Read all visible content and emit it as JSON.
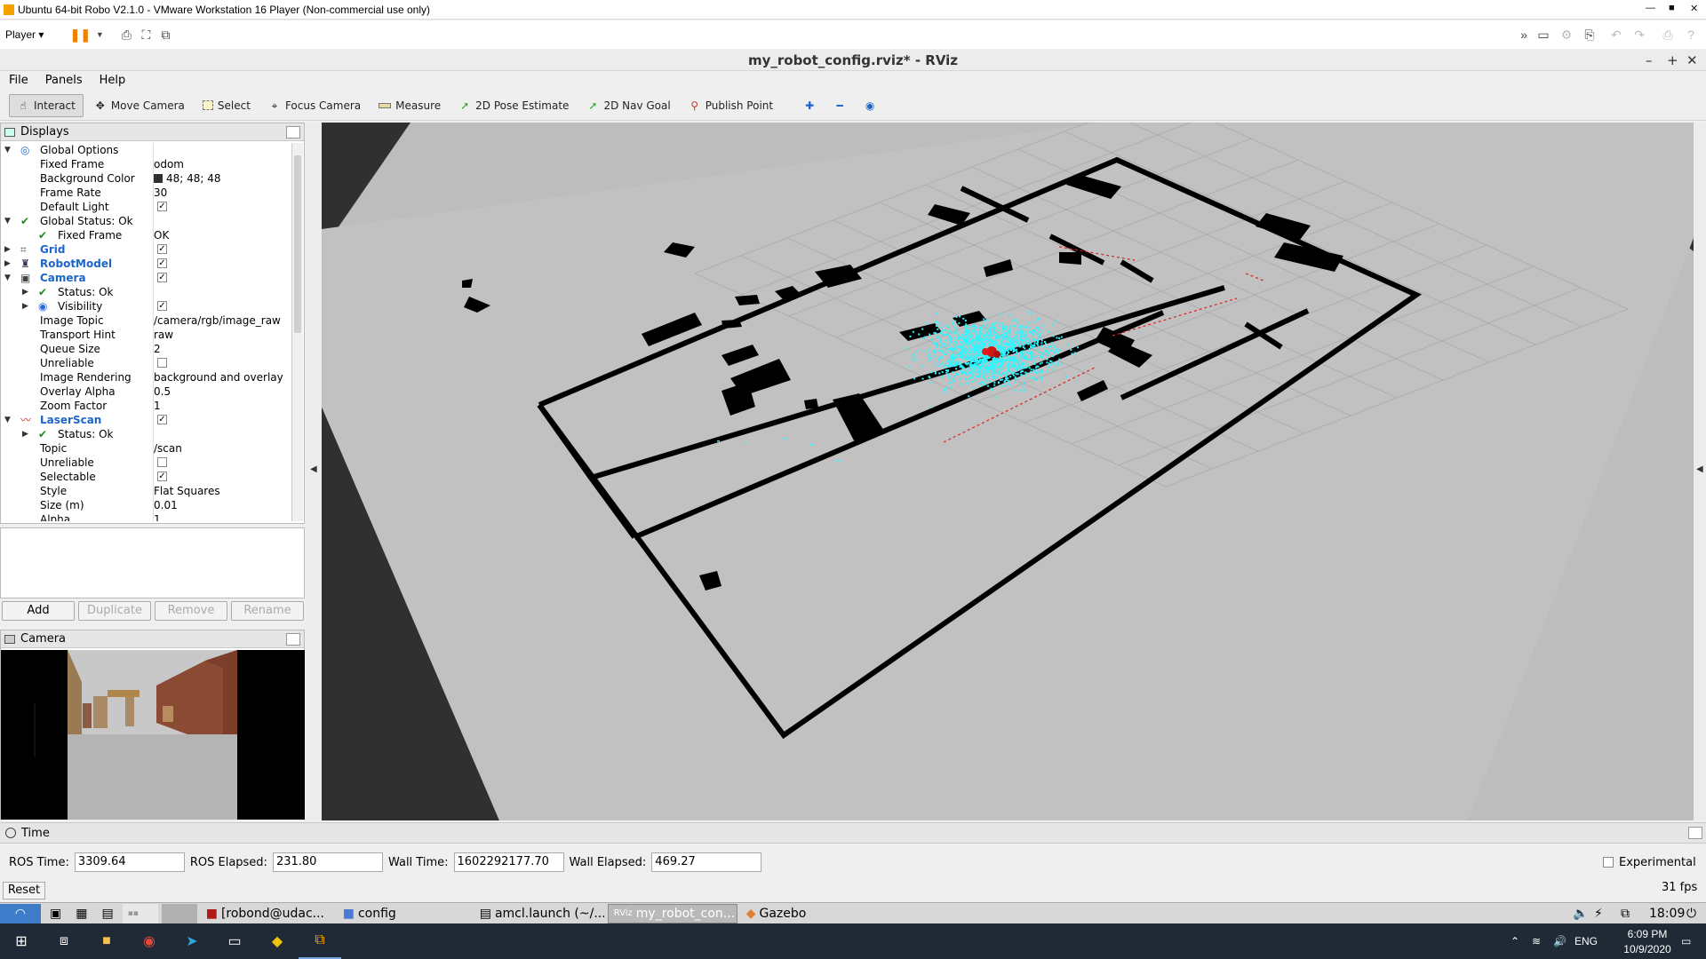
{
  "vm": {
    "title": "Ubuntu 64-bit Robo V2.1.0 - VMware Workstation 16 Player (Non-commercial use only)",
    "player_label": "Player"
  },
  "rviz": {
    "title": "my_robot_config.rviz* - RViz",
    "menu": [
      "File",
      "Panels",
      "Help"
    ],
    "tools": [
      {
        "label": "Interact",
        "icon": "cursor-icon",
        "active": true
      },
      {
        "label": "Move Camera",
        "icon": "move-icon"
      },
      {
        "label": "Select",
        "icon": "select-icon"
      },
      {
        "label": "Focus Camera",
        "icon": "focus-icon"
      },
      {
        "label": "Measure",
        "icon": "ruler-icon"
      },
      {
        "label": "2D Pose Estimate",
        "icon": "green-arrow-icon"
      },
      {
        "label": "2D Nav Goal",
        "icon": "green-arrow-icon"
      },
      {
        "label": "Publish Point",
        "icon": "pin-icon"
      }
    ]
  },
  "displays": {
    "title": "Displays",
    "rows": [
      {
        "level": 0,
        "arrow": "down",
        "icon": "globe",
        "key": "Global Options",
        "val": ""
      },
      {
        "level": 1,
        "key": "Fixed Frame",
        "val": "odom"
      },
      {
        "level": 1,
        "key": "Background Color",
        "val": "48; 48; 48",
        "swatch": true
      },
      {
        "level": 1,
        "key": "Frame Rate",
        "val": "30"
      },
      {
        "level": 1,
        "key": "Default Light",
        "check": true
      },
      {
        "level": 0,
        "arrow": "down",
        "icon": "check",
        "key": "Global Status: Ok",
        "val": ""
      },
      {
        "level": 1,
        "icon": "check",
        "key": "Fixed Frame",
        "val": "OK"
      },
      {
        "level": 0,
        "arrow": "right",
        "icon": "grid",
        "key": "Grid",
        "blue": true,
        "check": true
      },
      {
        "level": 0,
        "arrow": "right",
        "icon": "robot",
        "key": "RobotModel",
        "blue": true,
        "check": true
      },
      {
        "level": 0,
        "arrow": "down",
        "icon": "camera",
        "key": "Camera",
        "blue": true,
        "check": true
      },
      {
        "level": 1,
        "arrow": "right",
        "icon": "check",
        "key": "Status: Ok",
        "val": ""
      },
      {
        "level": 1,
        "arrow": "right",
        "icon": "eye",
        "key": "Visibility",
        "check": true
      },
      {
        "level": 1,
        "key": "Image Topic",
        "val": "/camera/rgb/image_raw"
      },
      {
        "level": 1,
        "key": "Transport Hint",
        "val": "raw"
      },
      {
        "level": 1,
        "key": "Queue Size",
        "val": "2"
      },
      {
        "level": 1,
        "key": "Unreliable",
        "check": false
      },
      {
        "level": 1,
        "key": "Image Rendering",
        "val": "background and overlay"
      },
      {
        "level": 1,
        "key": "Overlay Alpha",
        "val": "0.5"
      },
      {
        "level": 1,
        "key": "Zoom Factor",
        "val": "1"
      },
      {
        "level": 0,
        "arrow": "down",
        "icon": "laser",
        "key": "LaserScan",
        "blue": true,
        "check": true
      },
      {
        "level": 1,
        "arrow": "right",
        "icon": "check",
        "key": "Status: Ok",
        "val": ""
      },
      {
        "level": 1,
        "key": "Topic",
        "val": "/scan"
      },
      {
        "level": 1,
        "key": "Unreliable",
        "check": false
      },
      {
        "level": 1,
        "key": "Selectable",
        "check": true
      },
      {
        "level": 1,
        "key": "Style",
        "val": "Flat Squares"
      },
      {
        "level": 1,
        "key": "Size (m)",
        "val": "0.01"
      },
      {
        "level": 1,
        "key": "Alpha",
        "val": "1"
      }
    ],
    "buttons": [
      {
        "label": "Add",
        "enabled": true
      },
      {
        "label": "Duplicate",
        "enabled": false
      },
      {
        "label": "Remove",
        "enabled": false
      },
      {
        "label": "Rename",
        "enabled": false
      }
    ]
  },
  "camera_panel": {
    "title": "Camera"
  },
  "time": {
    "title": "Time",
    "ros_time_label": "ROS Time:",
    "ros_time": "3309.64",
    "ros_elapsed_label": "ROS Elapsed:",
    "ros_elapsed": "231.80",
    "wall_time_label": "Wall Time:",
    "wall_time": "1602292177.70",
    "wall_elapsed_label": "Wall Elapsed:",
    "wall_elapsed": "469.27",
    "experimental_label": "Experimental",
    "fps": "31 fps",
    "reset_label": "Reset"
  },
  "ubuntu_panel": {
    "tasks": [
      {
        "label": "[robond@udac...",
        "icon": "terminal-icon"
      },
      {
        "label": "config",
        "icon": "folder-icon"
      },
      {
        "label": "amcl.launch (~/...",
        "icon": "file-icon"
      },
      {
        "label": "my_robot_con...",
        "icon": "rviz-icon",
        "active": true
      },
      {
        "label": "Gazebo",
        "icon": "gazebo-icon"
      }
    ],
    "clock": "18:09"
  },
  "windows": {
    "lang": "ENG",
    "time": "6:09 PM",
    "date": "10/9/2020"
  },
  "colors": {
    "background": "#303030",
    "map_free": "#c4c4c4",
    "map_outside": "#bdbdbd",
    "laser": "#2ff5ff",
    "robot": "#d01818"
  }
}
